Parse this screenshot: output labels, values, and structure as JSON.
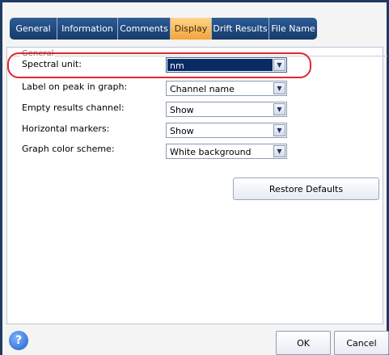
{
  "tabs": [
    {
      "label": "General",
      "active": false
    },
    {
      "label": "Information",
      "active": false
    },
    {
      "label": "Comments",
      "active": false
    },
    {
      "label": "Display",
      "active": true
    },
    {
      "label": "Drift Results",
      "active": false
    },
    {
      "label": "File Name",
      "active": false
    }
  ],
  "group": {
    "title": "General",
    "rows": [
      {
        "label": "Spectral unit:",
        "value": "nm",
        "selected": true
      },
      {
        "label": "Label on peak in graph:",
        "value": "Channel name"
      },
      {
        "label": "Empty results channel:",
        "value": "Show"
      },
      {
        "label": "Horizontal markers:",
        "value": "Show"
      },
      {
        "label": "Graph color scheme:",
        "value": "White background"
      }
    ]
  },
  "buttons": {
    "restore_defaults": "Restore Defaults",
    "ok": "OK",
    "cancel": "Cancel",
    "help": "?"
  },
  "colors": {
    "tab_bg": "#1f4a82",
    "tab_active": "#f2a33a",
    "highlight": "#e3262a",
    "selected_value_bg": "#0a2a63"
  },
  "icons": {
    "help": "help-icon",
    "dropdown": "chevron-down-icon"
  }
}
